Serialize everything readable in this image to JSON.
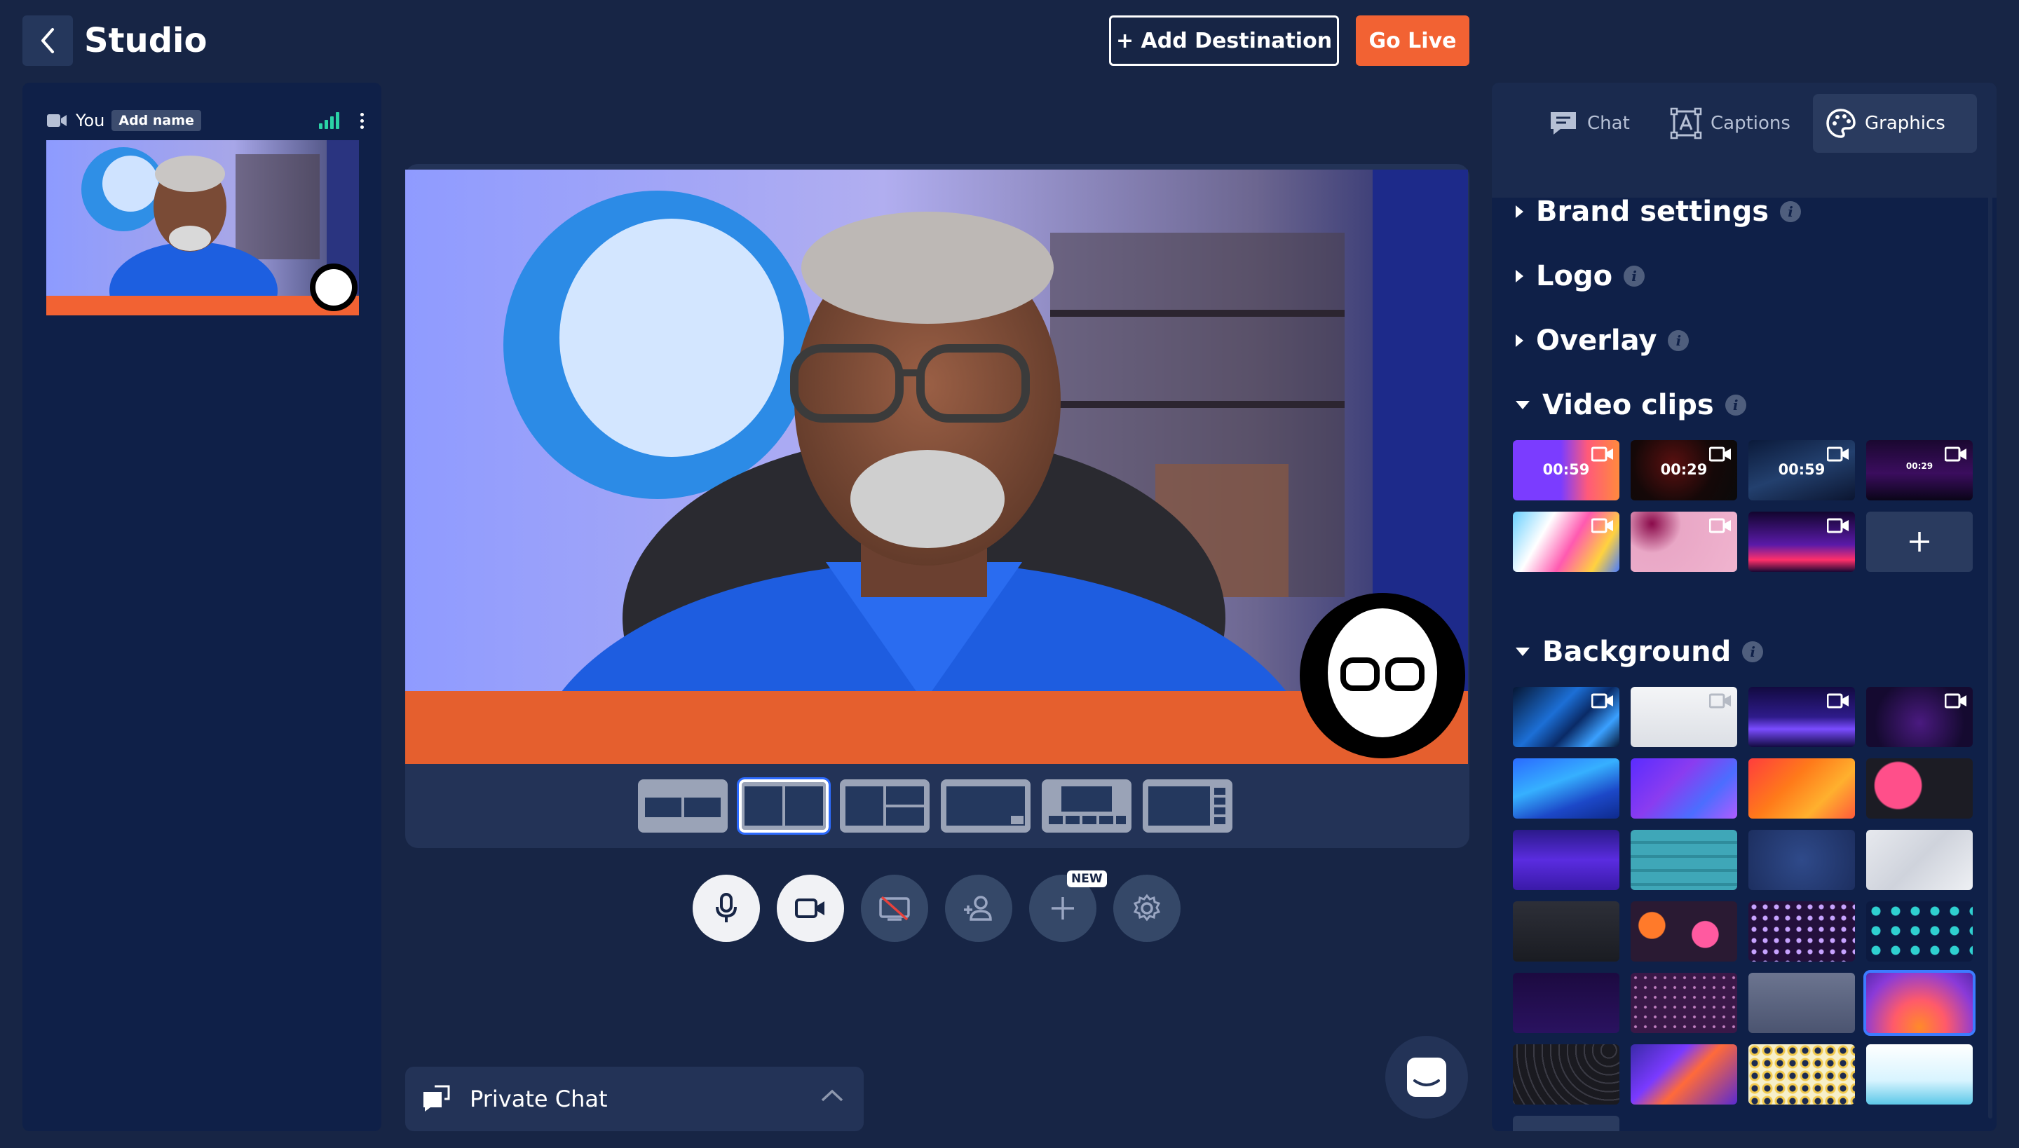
{
  "header": {
    "title": "Studio",
    "add_destination_label": "+ Add Destination",
    "go_live_label": "Go Live"
  },
  "participant": {
    "name": "You",
    "add_name_label": "Add name"
  },
  "layouts": [
    {
      "name": "layout-side-by-side-thin"
    },
    {
      "name": "layout-side-by-side",
      "active": true
    },
    {
      "name": "layout-grid-three"
    },
    {
      "name": "layout-pip"
    },
    {
      "name": "layout-filmstrip"
    },
    {
      "name": "layout-sidebar"
    }
  ],
  "controls": {
    "new_badge": "NEW",
    "icons": [
      "microphone-icon",
      "camera-icon",
      "screen-share-off-icon",
      "invite-guest-icon",
      "add-icon",
      "gear-icon"
    ]
  },
  "private_chat": {
    "label": "Private Chat"
  },
  "right_panel": {
    "tabs": [
      {
        "label": "Chat"
      },
      {
        "label": "Captions"
      },
      {
        "label": "Graphics",
        "active": true
      }
    ],
    "sections": {
      "brand_settings": "Brand settings",
      "logo": "Logo",
      "overlay": "Overlay",
      "video_clips": "Video clips",
      "background": "Background"
    },
    "info_glyph": "i",
    "video_clips": [
      {
        "duration": "00:59"
      },
      {
        "duration": "00:29"
      },
      {
        "duration": "00:59"
      },
      {
        "duration": "00:29"
      }
    ]
  },
  "colors": {
    "page_bg": "#172545",
    "panel_bg": "#0f2048",
    "accent_orange": "#f26233",
    "signal_green": "#2bd2a6",
    "selection_blue": "#3d7bff"
  }
}
